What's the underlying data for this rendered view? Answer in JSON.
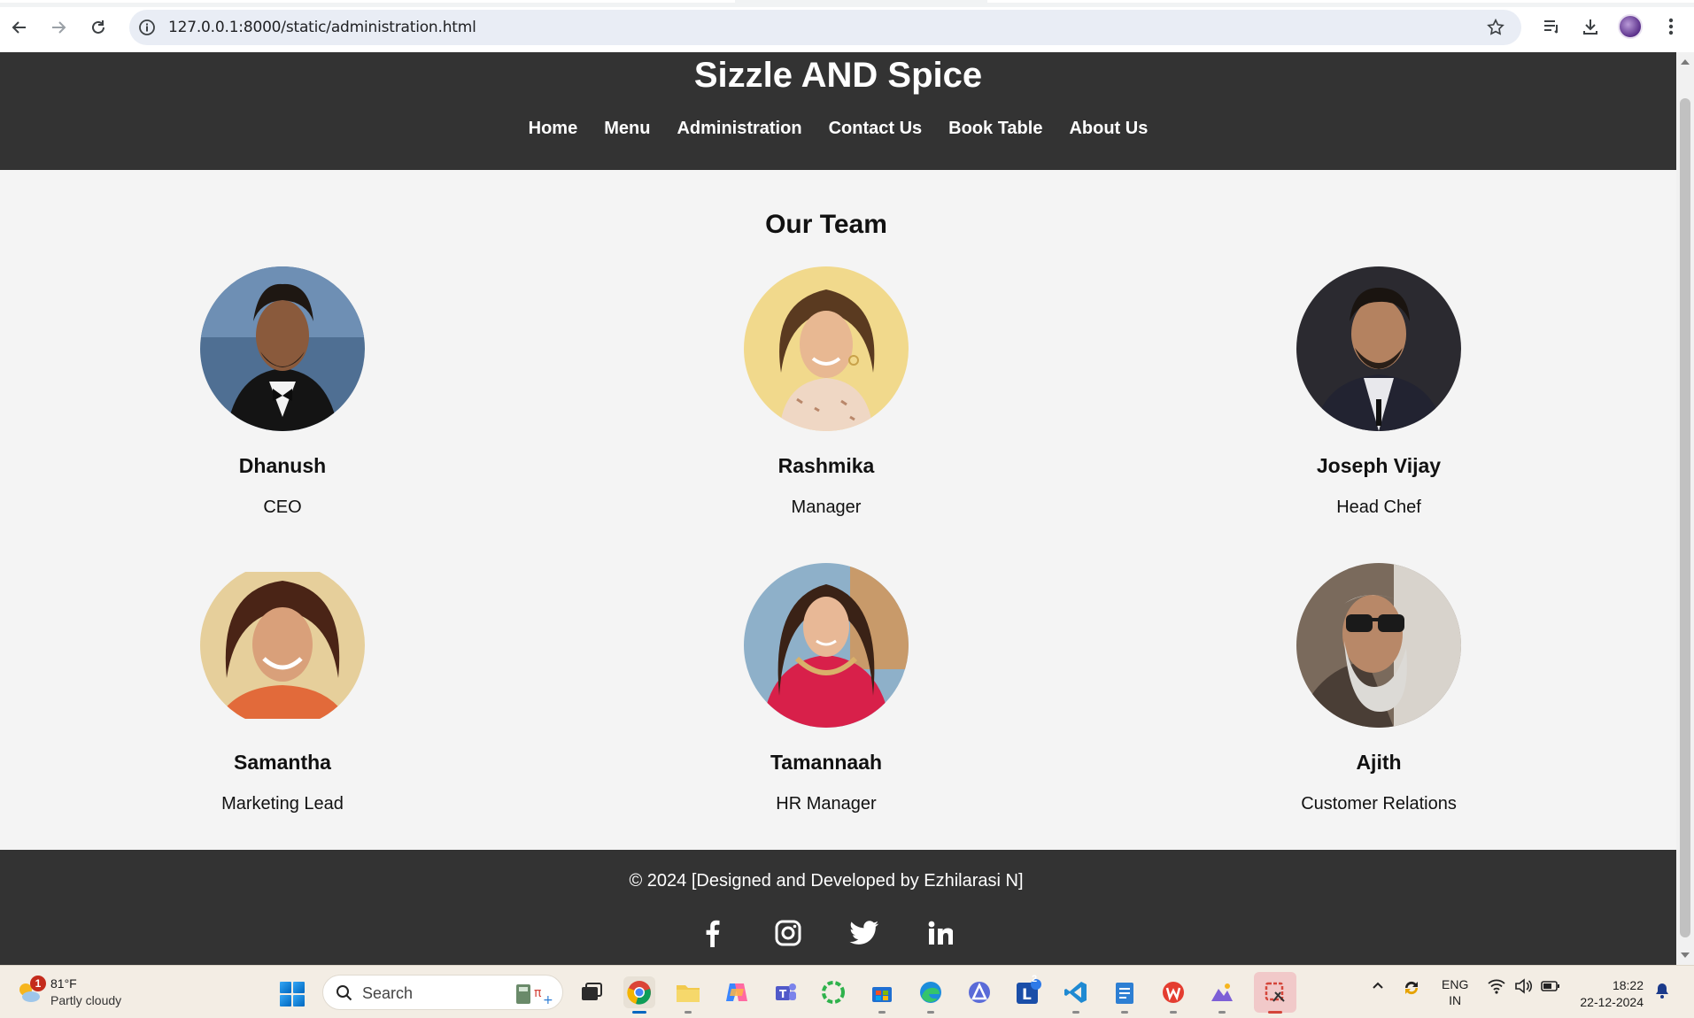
{
  "browser": {
    "url": "127.0.0.1:8000/static/administration.html"
  },
  "site": {
    "title": "Sizzle AND Spice",
    "nav": [
      "Home",
      "Menu",
      "Administration",
      "Contact Us",
      "Book Table",
      "About Us"
    ]
  },
  "team": {
    "heading": "Our Team",
    "members": [
      {
        "name": "Dhanush",
        "role": "CEO"
      },
      {
        "name": "Rashmika",
        "role": "Manager"
      },
      {
        "name": "Joseph Vijay",
        "role": "Head Chef"
      },
      {
        "name": "Samantha",
        "role": "Marketing Lead"
      },
      {
        "name": "Tamannaah",
        "role": "HR Manager"
      },
      {
        "name": "Ajith",
        "role": "Customer Relations"
      }
    ]
  },
  "footer": {
    "copyright": "© 2024 [Designed and Developed by Ezhilarasi N]",
    "socials": [
      "facebook-icon",
      "instagram-icon",
      "twitter-icon",
      "linkedin-icon"
    ]
  },
  "taskbar": {
    "weather_temp": "81°F",
    "weather_cond": "Partly cloudy",
    "weather_badge": "1",
    "search_label": "Search",
    "lang_top": "ENG",
    "lang_bottom": "IN",
    "time": "18:22",
    "date": "22-12-2024",
    "mail_badge": "2"
  },
  "colors": {
    "header_bg": "#333333",
    "page_bg": "#f4f4f4",
    "omnibox_bg": "#e9edf5"
  }
}
